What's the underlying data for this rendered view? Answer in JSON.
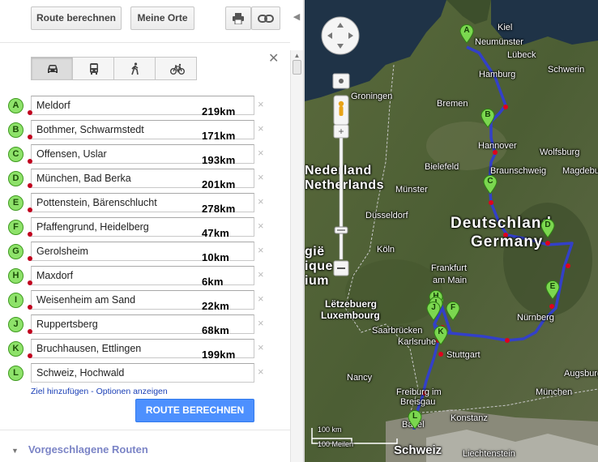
{
  "toolbar": {
    "route_label": "Route berechnen",
    "places_label": "Meine Orte"
  },
  "modes": [
    {
      "name": "car",
      "icon": "car-icon",
      "selected": true
    },
    {
      "name": "transit",
      "icon": "bus-icon",
      "selected": false
    },
    {
      "name": "walking",
      "icon": "walk-icon",
      "selected": false
    },
    {
      "name": "bicycling",
      "icon": "bike-icon",
      "selected": false
    }
  ],
  "waypoints": [
    {
      "letter": "A",
      "value": "Meldorf",
      "distance": "219km"
    },
    {
      "letter": "B",
      "value": "Bothmer, Schwarmstedt",
      "distance": "171km"
    },
    {
      "letter": "C",
      "value": "Offensen, Uslar",
      "distance": "193km"
    },
    {
      "letter": "D",
      "value": "München, Bad Berka",
      "distance": "201km"
    },
    {
      "letter": "E",
      "value": "Pottenstein, Bärenschlucht",
      "distance": "278km"
    },
    {
      "letter": "F",
      "value": "Pfaffengrund, Heidelberg",
      "distance": "47km"
    },
    {
      "letter": "G",
      "value": "Gerolsheim",
      "distance": "10km"
    },
    {
      "letter": "H",
      "value": "Maxdorf",
      "distance": "6km"
    },
    {
      "letter": "I",
      "value": "Weisenheim am Sand",
      "distance": "22km"
    },
    {
      "letter": "J",
      "value": "Ruppertsberg",
      "distance": "68km"
    },
    {
      "letter": "K",
      "value": "Bruchhausen, Ettlingen",
      "distance": "199km"
    },
    {
      "letter": "L",
      "value": "Schweiz, Hochwald",
      "distance": ""
    }
  ],
  "links": {
    "add_destination": "Ziel hinzufügen",
    "separator": " - ",
    "show_options": "Optionen anzeigen"
  },
  "calculate_label": "ROUTE BERECHNEN",
  "suggested_label": "Vorgeschlagene Routen",
  "map": {
    "country_labels": {
      "netherlands_1": "Nederland",
      "netherlands_2": "Netherlands",
      "germany_1": "Deutschland",
      "germany_2": "Germany",
      "luxembourg_1": "Lëtzebuerg",
      "luxembourg_2": "Luxembourg",
      "belgium_1": "gië",
      "belgium_2": "ique",
      "belgium_3": "ium",
      "switzerland": "Schweiz",
      "liechtenstein": "Liechtenstein"
    },
    "cities": [
      "Kiel",
      "Neumünster",
      "Lübeck",
      "Schwerin",
      "Hamburg",
      "Groningen",
      "Bremen",
      "Hannover",
      "Wolfsburg",
      "Bielefeld",
      "Braunschweig",
      "Magdeburg",
      "Münster",
      "Düsseldorf",
      "Köln",
      "Frankfurt",
      "am Main",
      "Nürnberg",
      "Saarbrücken",
      "Karlsruhe",
      "Stuttgart",
      "Nancy",
      "Freiburg im",
      "Breisgau",
      "Augsburg",
      "München",
      "Konstanz",
      "Basel"
    ],
    "scale_km": "100 km",
    "scale_miles": "100 Meilen"
  }
}
